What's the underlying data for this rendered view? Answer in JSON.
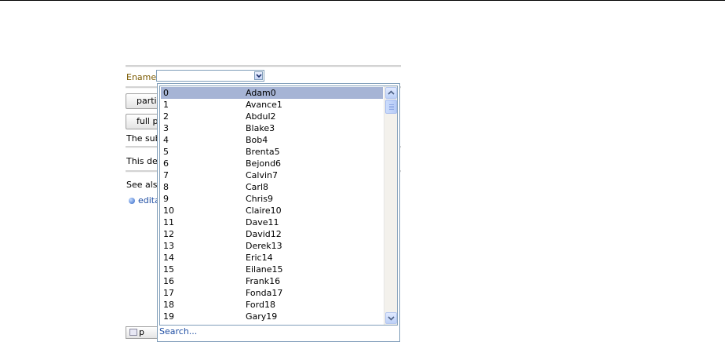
{
  "form": {
    "ename_label": "Ename",
    "combo_value": ""
  },
  "buttons": {
    "partial_label": "partia",
    "full_label": "full po",
    "bottom_label": "p"
  },
  "text": {
    "submitted": "The subm",
    "demo": "This dem",
    "see_also": "See also",
    "link": "edita"
  },
  "dropdown": {
    "selected_index": 0,
    "rows": [
      {
        "id": "0",
        "name": "Adam0"
      },
      {
        "id": "1",
        "name": "Avance1"
      },
      {
        "id": "2",
        "name": "Abdul2"
      },
      {
        "id": "3",
        "name": "Blake3"
      },
      {
        "id": "4",
        "name": "Bob4"
      },
      {
        "id": "5",
        "name": "Brenta5"
      },
      {
        "id": "6",
        "name": "Bejond6"
      },
      {
        "id": "7",
        "name": "Calvin7"
      },
      {
        "id": "8",
        "name": "Carl8"
      },
      {
        "id": "9",
        "name": "Chris9"
      },
      {
        "id": "10",
        "name": "Claire10"
      },
      {
        "id": "11",
        "name": "Dave11"
      },
      {
        "id": "12",
        "name": "David12"
      },
      {
        "id": "13",
        "name": "Derek13"
      },
      {
        "id": "14",
        "name": "Eric14"
      },
      {
        "id": "15",
        "name": "Eilane15"
      },
      {
        "id": "16",
        "name": "Frank16"
      },
      {
        "id": "17",
        "name": "Fonda17"
      },
      {
        "id": "18",
        "name": "Ford18"
      },
      {
        "id": "19",
        "name": "Gary19"
      }
    ],
    "search_label": "Search..."
  },
  "colors": {
    "selected_row": "#a6b4d5",
    "border": "#7f9db9",
    "link": "#1f4ea3"
  }
}
